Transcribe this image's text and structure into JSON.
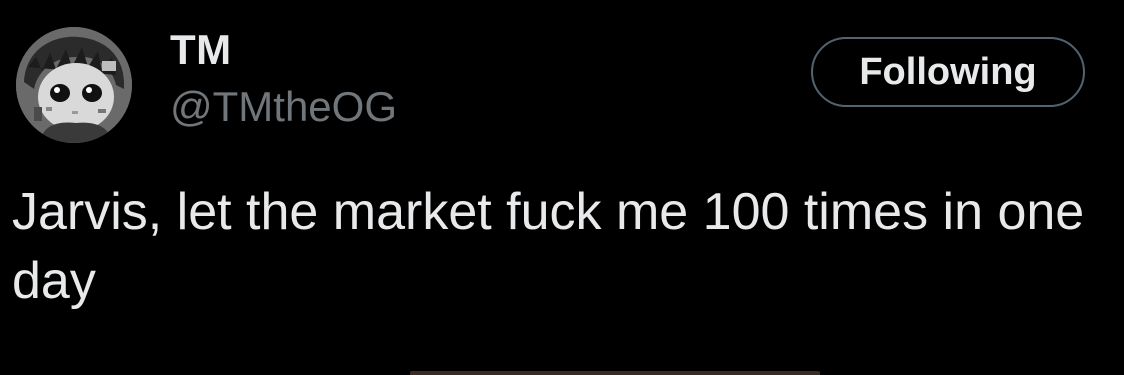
{
  "user": {
    "display_name": "TM",
    "handle": "@TMtheOG"
  },
  "follow_button": {
    "label": "Following"
  },
  "tweet": {
    "text": "Jarvis, let the market fuck me 100 times in one day"
  },
  "icons": {
    "avatar": "grayscale-anime-avatar"
  },
  "colors": {
    "background": "#000000",
    "primary_text": "#e7e9ea",
    "secondary_text": "#71767b",
    "button_border": "#536471"
  }
}
